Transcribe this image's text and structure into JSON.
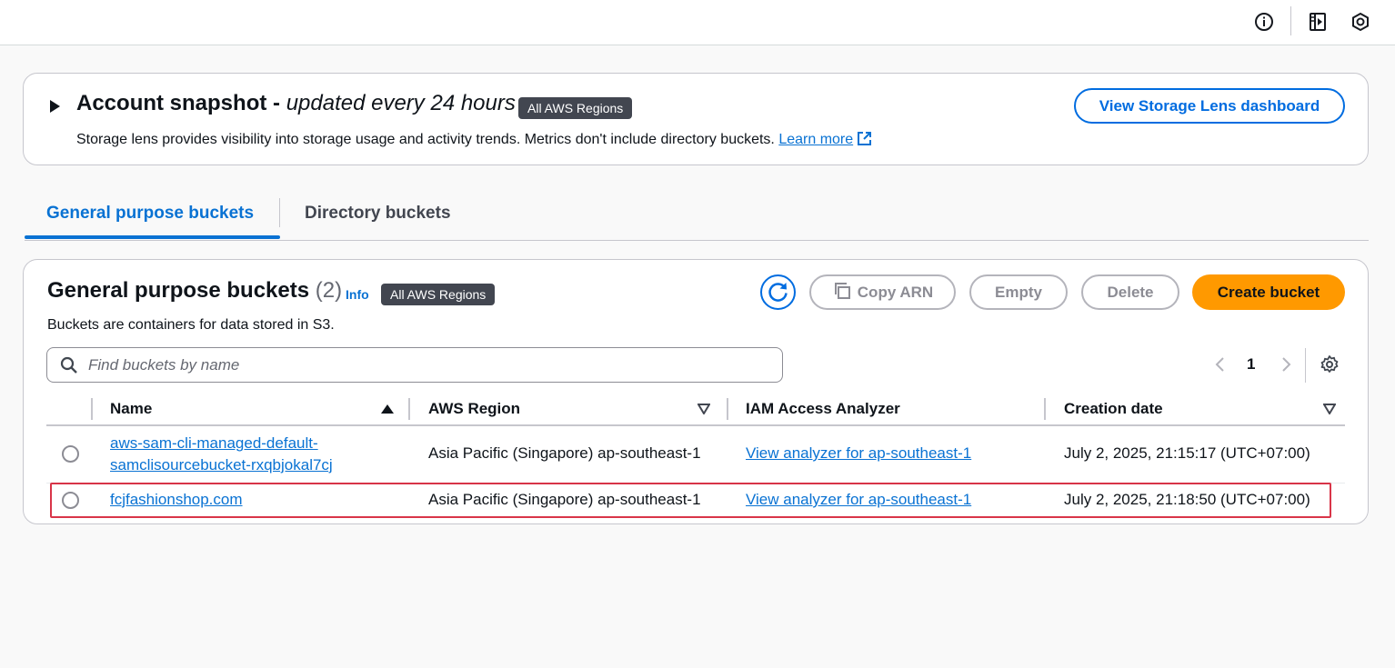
{
  "topbar": {
    "icons": [
      "info-icon",
      "side-panel-icon",
      "hexagon-icon"
    ]
  },
  "snapshot": {
    "title_bold": "Account snapshot -",
    "title_italic": "updated every 24 hours",
    "badge": "All AWS Regions",
    "description": "Storage lens provides visibility into storage usage and activity trends. Metrics don't include directory buckets.",
    "learn_more": "Learn more",
    "dashboard_button": "View Storage Lens dashboard"
  },
  "tabs": [
    {
      "label": "General purpose buckets",
      "active": true
    },
    {
      "label": "Directory buckets",
      "active": false
    }
  ],
  "buckets_panel": {
    "title": "General purpose buckets",
    "count": "(2)",
    "info": "Info",
    "badge": "All AWS Regions",
    "subtitle": "Buckets are containers for data stored in S3.",
    "buttons": {
      "copy_arn": "Copy ARN",
      "empty": "Empty",
      "delete": "Delete",
      "create": "Create bucket"
    },
    "search_placeholder": "Find buckets by name",
    "page": "1",
    "columns": [
      "Name",
      "AWS Region",
      "IAM Access Analyzer",
      "Creation date"
    ],
    "rows": [
      {
        "name_line1": "aws-sam-cli-managed-default-",
        "name_line2": "samclisourcebucket-rxqbjokal7cj",
        "region": "Asia Pacific (Singapore) ap-southeast-1",
        "analyzer": "View analyzer for ap-southeast-1",
        "created": "July 2, 2025, 21:15:17 (UTC+07:00)"
      },
      {
        "name_line1": "fcjfashionshop.com",
        "region": "Asia Pacific (Singapore) ap-southeast-1",
        "analyzer": "View analyzer for ap-southeast-1",
        "created": "July 2, 2025, 21:18:50 (UTC+07:00)"
      }
    ]
  },
  "colors": {
    "accent": "#0972d3",
    "primary_button": "#ff9900",
    "highlight": "#d0021b"
  }
}
